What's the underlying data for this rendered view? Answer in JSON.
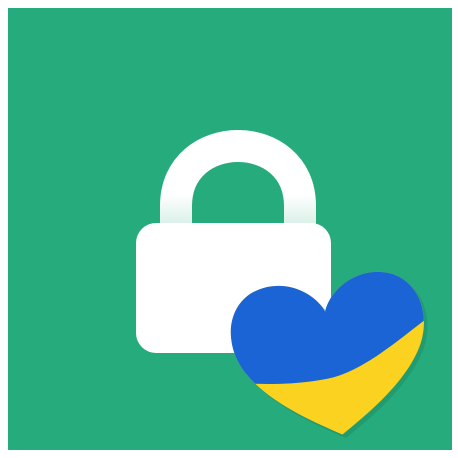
{
  "icon": {
    "name": "lock-with-ukraine-heart",
    "elements": [
      "lock-icon",
      "heart-icon"
    ]
  },
  "colors": {
    "background": "#FFFFFF",
    "tile": "#26AB7D",
    "lock_body": "#FFFFFF",
    "lock_shackle_top": "#FFFFFF",
    "lock_shackle_bottom": "#CDEBE0",
    "heart_blue": "#1B64D6",
    "heart_yellow": "#FCD220",
    "heart_shadow": "#1E8F68"
  }
}
